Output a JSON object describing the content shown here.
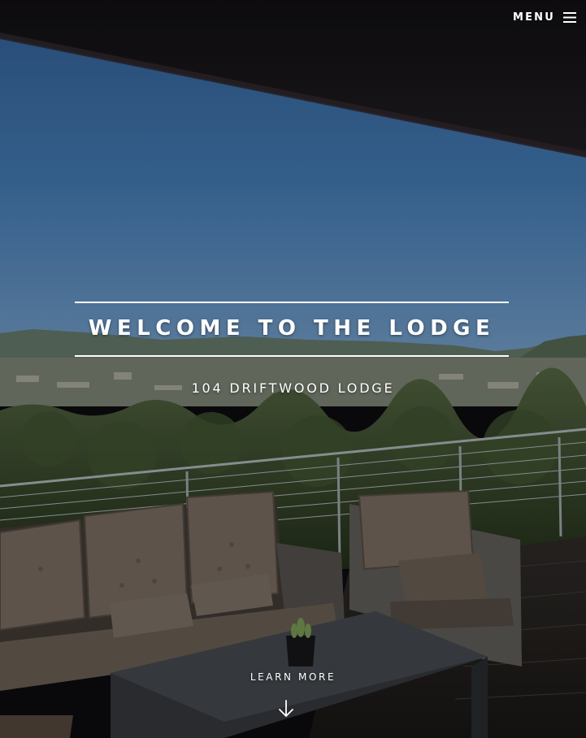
{
  "header": {
    "menu_label": "MENU",
    "menu_icon": "hamburger-icon"
  },
  "hero": {
    "title": "WELCOME TO THE LODGE",
    "subtitle": "104 DRIFTWOOD LODGE",
    "cta_label": "LEARN MORE",
    "cta_icon": "arrow-down-icon",
    "background": "photo of a covered deck with wicker lounge furniture overlooking a wooded valley and distant hills under a blue sky"
  },
  "colors": {
    "text": "#ffffff",
    "sky": "#3a6a9c",
    "roof": "#141216"
  }
}
